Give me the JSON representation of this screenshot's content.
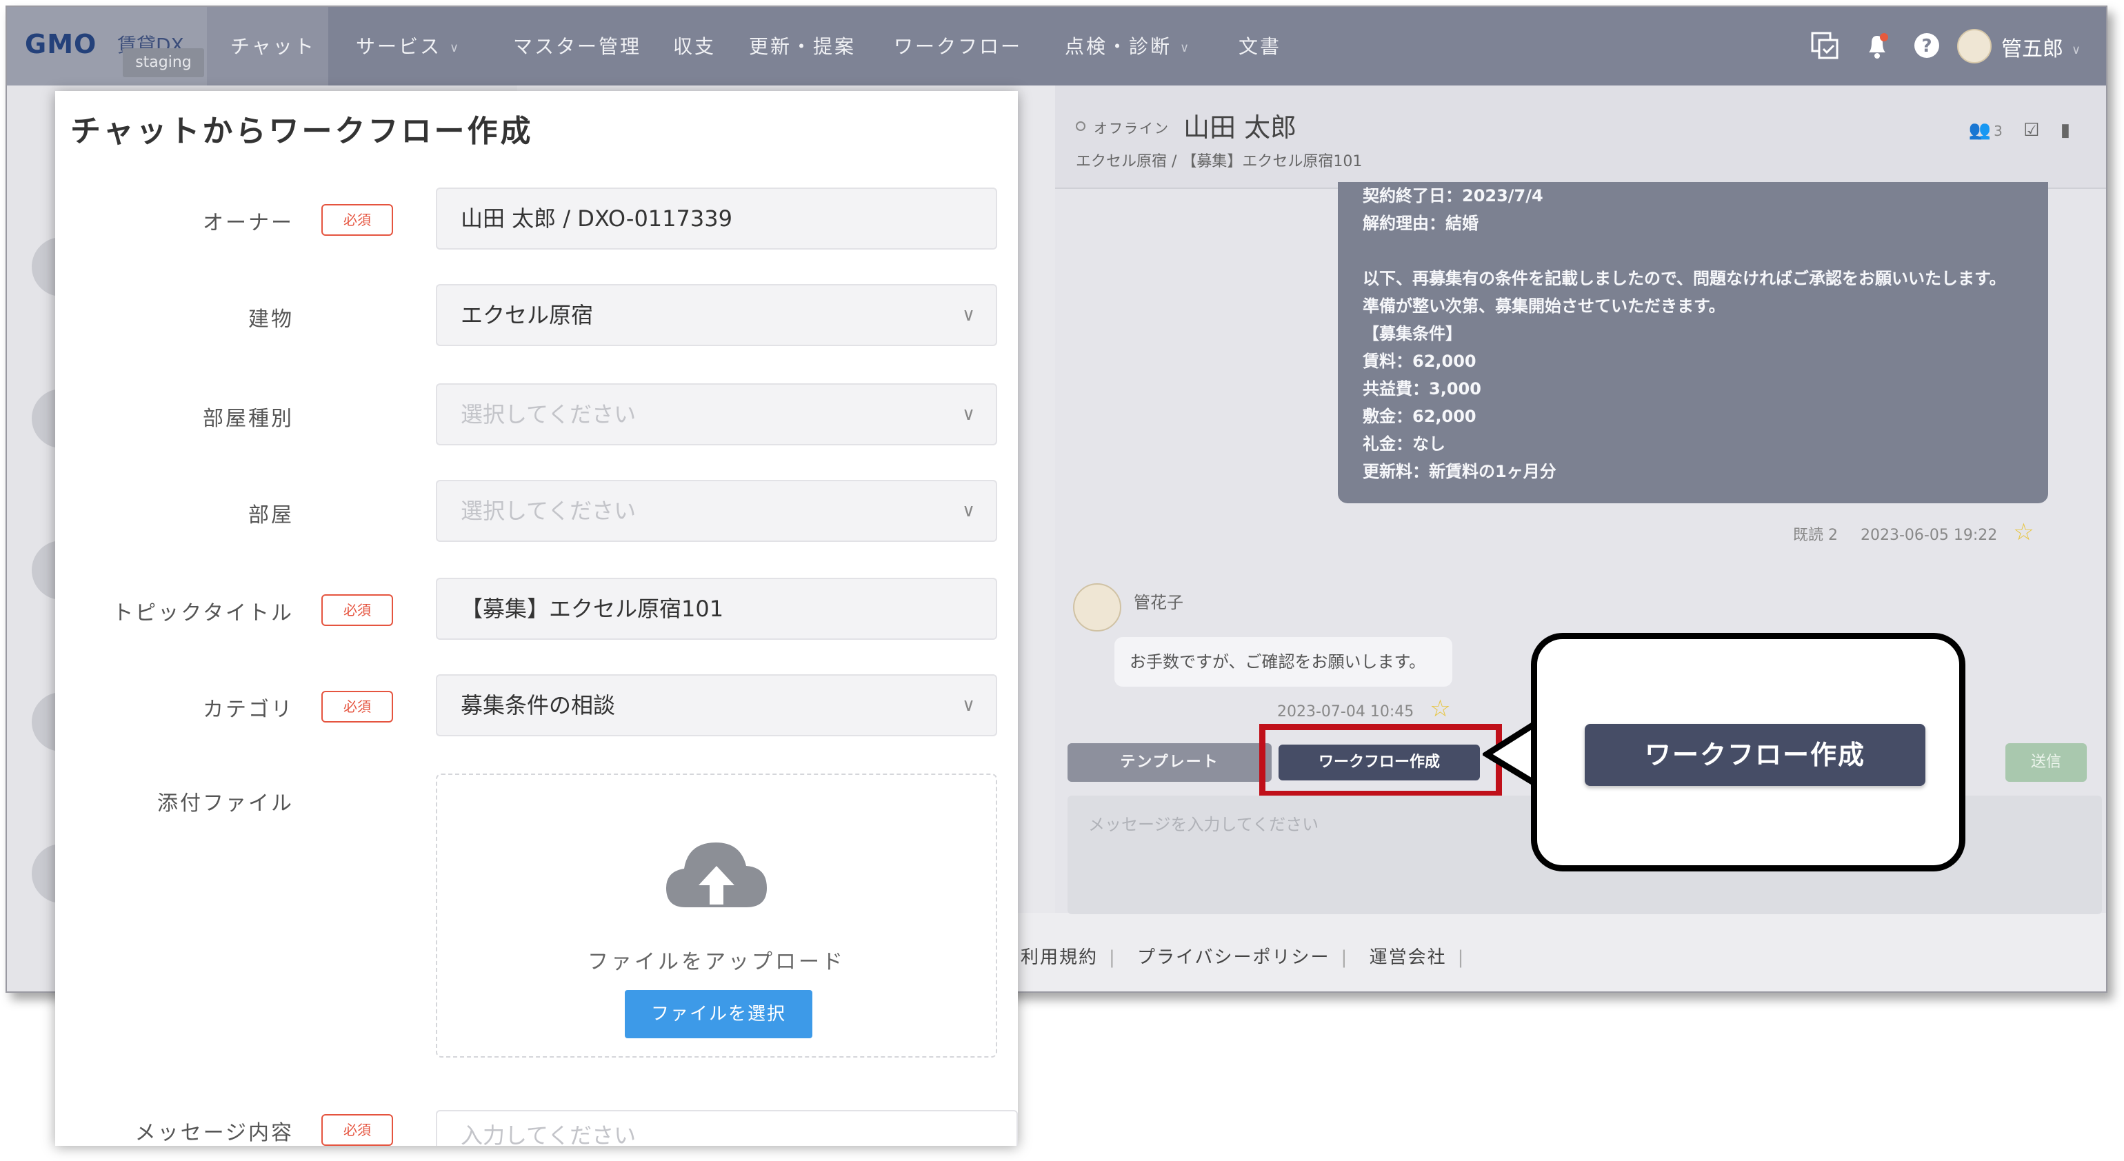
{
  "nav": {
    "logo": "GMO",
    "logo_sub": "賃貸DX",
    "staging": "staging",
    "items": [
      {
        "label": "チャット",
        "caret": false
      },
      {
        "label": "サービス",
        "caret": true
      },
      {
        "label": "マスター管理",
        "caret": false
      },
      {
        "label": "収支",
        "caret": false
      },
      {
        "label": "更新・提案",
        "caret": false
      },
      {
        "label": "ワークフロー",
        "caret": false
      },
      {
        "label": "点検・診断",
        "caret": true
      },
      {
        "label": "文書",
        "caret": false
      }
    ],
    "user_name": "管五郎",
    "icons": [
      "copy-check-icon",
      "bell-icon",
      "help-icon",
      "user-avatar"
    ]
  },
  "modal": {
    "title": "チャットからワークフロー作成",
    "required_label": "必須",
    "fields": [
      {
        "label": "オーナー",
        "required": true,
        "value": "山田 太郎 / DXO-0117339",
        "dropdown": false,
        "placeholder": false
      },
      {
        "label": "建物",
        "required": false,
        "value": "エクセル原宿",
        "dropdown": true,
        "placeholder": false
      },
      {
        "label": "部屋種別",
        "required": false,
        "value": "選択してください",
        "dropdown": true,
        "placeholder": true
      },
      {
        "label": "部屋",
        "required": false,
        "value": "選択してください",
        "dropdown": true,
        "placeholder": true
      },
      {
        "label": "トピックタイトル",
        "required": true,
        "value": "【募集】エクセル原宿101",
        "dropdown": false,
        "placeholder": false
      },
      {
        "label": "カテゴリ",
        "required": true,
        "value": "募集条件の相談",
        "dropdown": true,
        "placeholder": false
      }
    ],
    "attachment_label": "添付ファイル",
    "upload_text": "ファイルをアップロード",
    "upload_button": "ファイルを選択",
    "message_label": "メッセージ内容",
    "message_placeholder": "入力してください"
  },
  "chat": {
    "status": "オフライン",
    "name": "山田 太郎",
    "subtitle": "エクセル原宿 / 【募集】エクセル原宿101",
    "member_count": "3",
    "bubble_lines": [
      "契約終了日：2023/7/4",
      "解約理由：結婚",
      "",
      "以下、再募集有の条件を記載しましたので、問題なければご承認をお願いいたします。",
      "準備が整い次第、募集開始させていただきます。",
      "【募集条件】",
      "賃料：62,000",
      "共益費：3,000",
      "敷金：62,000",
      "礼金：なし",
      "更新料：新賃料の1ヶ月分"
    ],
    "read_meta": "既読 2",
    "time1": "2023-06-05 19:22",
    "sender": "管花子",
    "reply": "お手数ですが、ご確認をお願いします。",
    "time2": "2023-07-04 10:45",
    "template_button": "テンプレート",
    "workflow_button": "ワークフロー作成",
    "send_button": "送信",
    "message_placeholder": "メッセージを入力してください"
  },
  "footer": {
    "links": [
      "利用規約",
      "プライバシーポリシー",
      "運営会社"
    ]
  },
  "callout": {
    "button": "ワークフロー作成"
  },
  "colors": {
    "nav_bg": "#7e8395",
    "required": "#e5543f",
    "primary_dark": "#464d66",
    "upload_button": "#3d9ae8",
    "highlight": "#c0101a"
  }
}
